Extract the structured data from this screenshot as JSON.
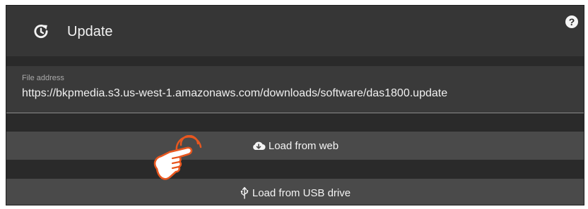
{
  "header": {
    "title": "Update",
    "refresh_icon": "refresh-icon",
    "help_icon": "help-icon",
    "help_glyph": "?"
  },
  "file_address": {
    "label": "File address",
    "value": "https://bkpmedia.s3.us-west-1.amazonaws.com/downloads/software/das1800.update"
  },
  "buttons": {
    "load_web": {
      "label": "Load from web",
      "icon": "cloud-download-icon"
    },
    "load_usb": {
      "label": "Load from USB drive",
      "icon": "usb-icon"
    }
  },
  "overlay": {
    "icon": "pointing-hand-icon"
  },
  "colors": {
    "panel": "#2a2a2a",
    "header": "#363636",
    "field": "#3a3a3a",
    "button": "#4a4a4a",
    "text": "#f2f2f2",
    "hand_accent": "#e8571f"
  }
}
